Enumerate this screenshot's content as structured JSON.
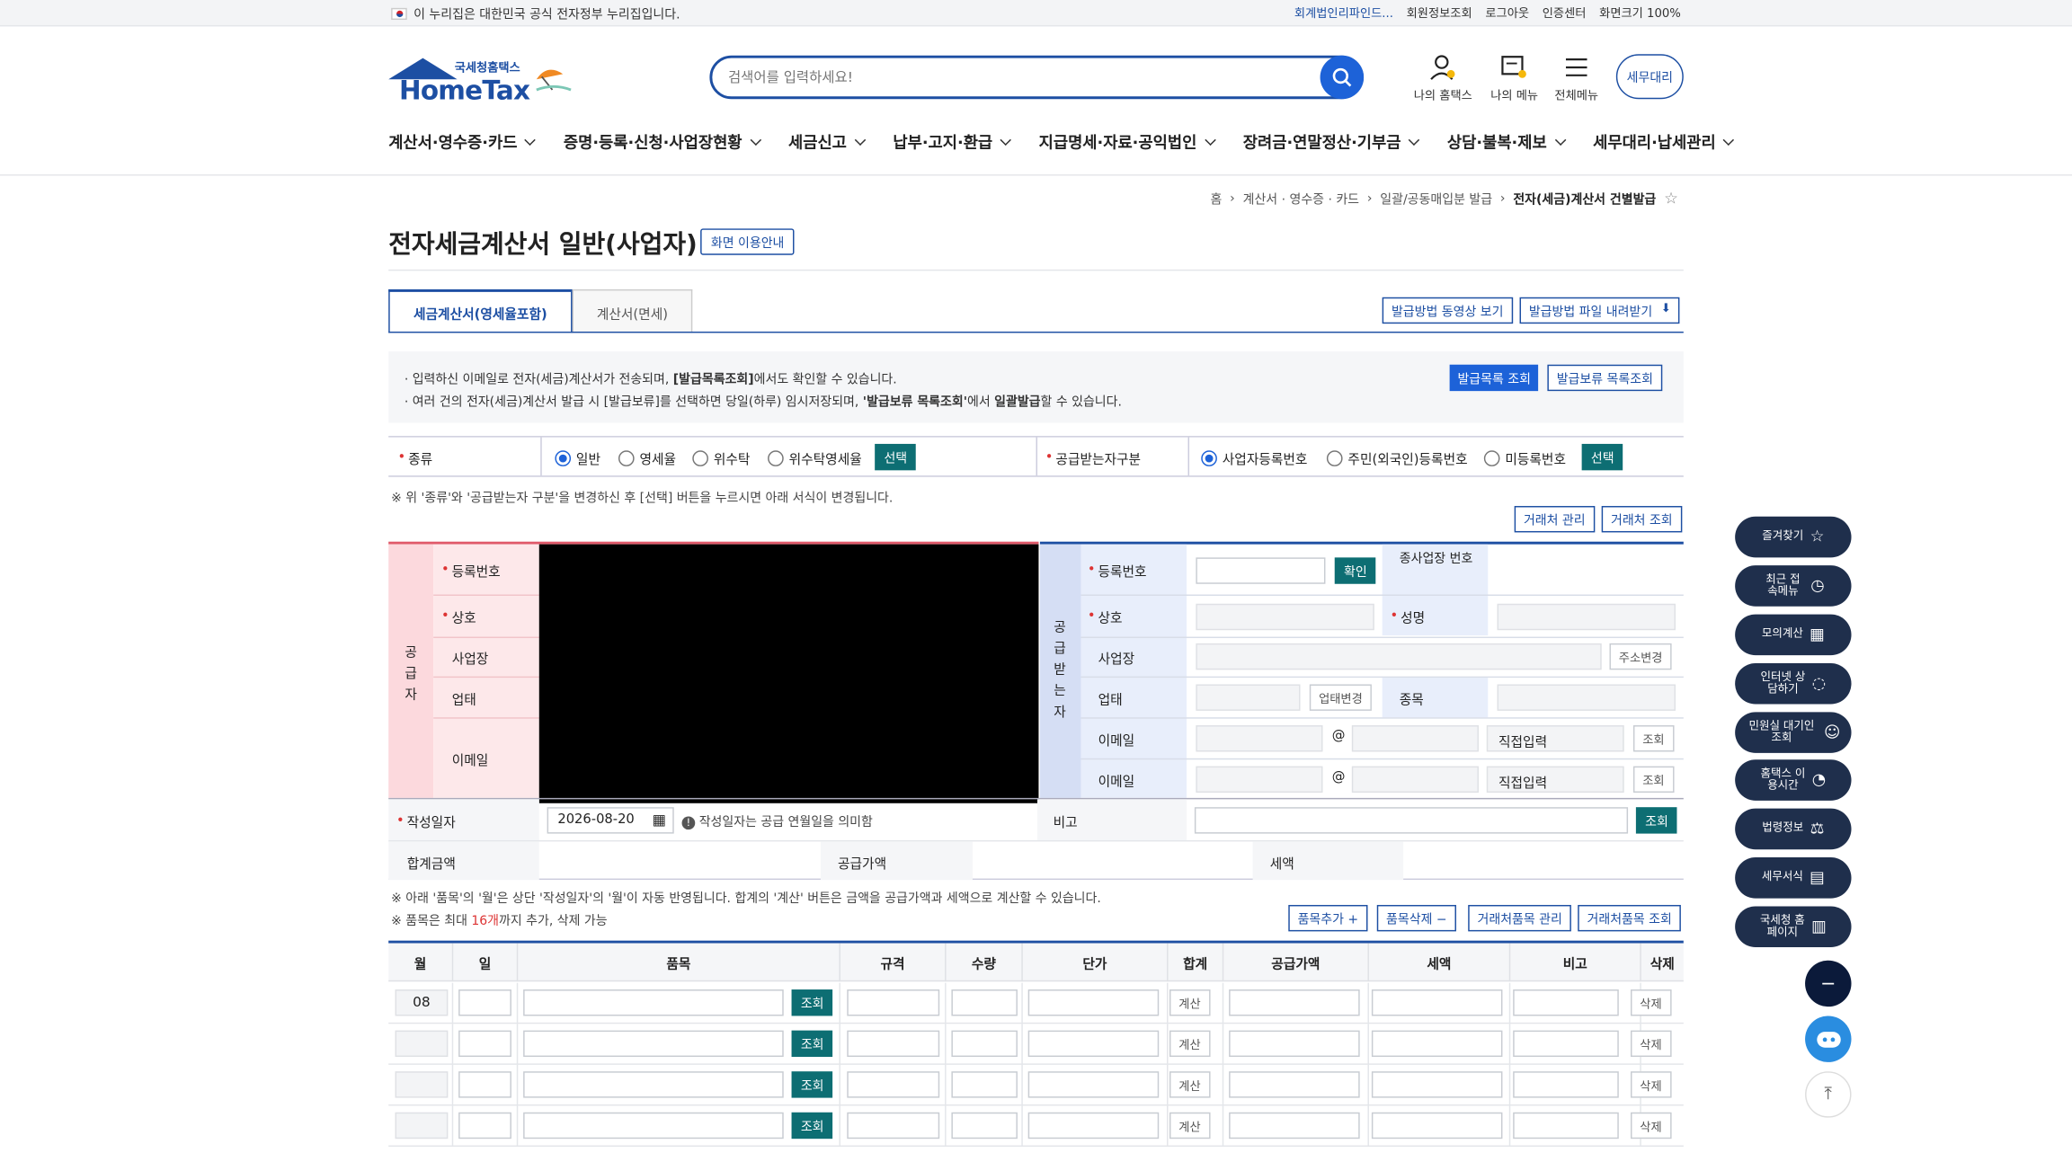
{
  "topbar": {
    "notice": "이 누리집은 대한민국 공식 전자정부 누리집입니다.",
    "links": [
      "회계법인리파인드...",
      "회원정보조회",
      "로그아웃",
      "인증센터",
      "화면크기 100%"
    ]
  },
  "logo": {
    "small": "국세청홈택스",
    "big": "HomeTax"
  },
  "search": {
    "placeholder": "검색어를 입력하세요!"
  },
  "header_icons": [
    "나의 홈택스",
    "나의 메뉴",
    "전체메뉴"
  ],
  "semu_label": "세무대리",
  "gnb": [
    "계산서·영수증·카드",
    "증명·등록·신청·사업장현황",
    "세금신고",
    "납부·고지·환급",
    "지급명세·자료·공익법인",
    "장려금·연말정산·기부금",
    "상담·불복·제보",
    "세무대리·납세관리"
  ],
  "breadcrumb": [
    "홈",
    "계산서 · 영수증 · 카드",
    "일괄/공동매입분 발급",
    "전자(세금)계산서 건별발급"
  ],
  "page_title": "전자세금계산서 일반(사업자)",
  "guide_button": "화면 이용안내",
  "tabs": [
    "세금계산서(영세율포함)",
    "계산서(면세)"
  ],
  "tab_buttons": [
    "발급방법 동영상 보기",
    "발급방법 파일 내려받기"
  ],
  "info": {
    "line1_a": "· 입력하신 이메일로 전자(세금)계산서가 전송되며, ",
    "line1_b": "[발급목록조회]",
    "line1_c": "에서도 확인할 수 있습니다.",
    "line2_a": "· 여러 건의 전자(세금)계산서 발급 시 [발급보류]를 선택하면 당일(하루) 임시저장되며, ",
    "line2_b": "'발급보류 목록조회'",
    "line2_c": "에서 ",
    "line2_d": "일괄발급",
    "line2_e": "할 수 있습니다.",
    "btn1": "발급목록 조회",
    "btn2": "발급보류 목록조회"
  },
  "type": {
    "label": "종류",
    "options": [
      "일반",
      "영세율",
      "위수탁",
      "위수탁영세율"
    ],
    "select": "선택",
    "recv_label": "공급받는자구분",
    "recv_options": [
      "사업자등록번호",
      "주민(외국인)등록번호",
      "미등록번호"
    ]
  },
  "type_note": "※ 위 '종류'와 '공급받는자 구분'을 변경하신 후 [선택] 버튼을 누르시면 아래 서식이 변경됩니다.",
  "partner_buttons": [
    "거래처 관리",
    "거래처 조회"
  ],
  "supplier": {
    "side": "공급자",
    "rows": [
      "등록번호",
      "상호",
      "사업장",
      "업태",
      "이메일"
    ]
  },
  "receiver": {
    "side": "공급받는자",
    "reg": "등록번호",
    "confirm": "확인",
    "sub": "종사업장 번호",
    "name": "상호",
    "ceo": "성명",
    "addr": "사업장",
    "addr_btn": "주소변경",
    "biz": "업태",
    "biz_btn": "업태변경",
    "item": "종목",
    "email": "이메일",
    "at": "@",
    "direct": "직접입력",
    "lookup": "조회"
  },
  "date": {
    "label": "작성일자",
    "value": "2026-08-20",
    "hint": "작성일자는 공급 연월일을 의미함",
    "remark": "비고",
    "lookup": "조회"
  },
  "sums": {
    "total": "합계금액",
    "supply": "공급가액",
    "tax": "세액"
  },
  "item_notes": {
    "n1": "※ 아래 '품목'의 '월'은 상단 '작성일자'의 '월'이 자동 반영됩니다. 합계의 '계산' 버튼은 금액을 공급가액과 세액으로 계산할 수 있습니다.",
    "n2a": "※ 품목은 최대 ",
    "n2b": "16개",
    "n2c": "까지 추가, 삭제 가능"
  },
  "item_buttons": [
    "품목추가 +",
    "품목삭제 −",
    "거래처품목 관리",
    "거래처품목 조회"
  ],
  "table": {
    "headers": [
      "월",
      "일",
      "품목",
      "규격",
      "수량",
      "단가",
      "합계",
      "공급가액",
      "세액",
      "비고",
      "삭제"
    ],
    "month": "08",
    "lookup": "조회",
    "calc": "계산",
    "del": "삭제"
  },
  "fabs": [
    "즐겨찾기",
    "최근 접속메뉴",
    "모의계산",
    "인터넷 상담하기",
    "민원실 대기인 조회",
    "홈택스 이용시간",
    "법령정보",
    "세무서식",
    "국세청 홈페이지"
  ],
  "colors": {
    "primary": "#1d4fa3",
    "teal": "#0d6e73",
    "supplier_bg": "#fde8ea",
    "receiver_bg": "#e8eefb"
  }
}
